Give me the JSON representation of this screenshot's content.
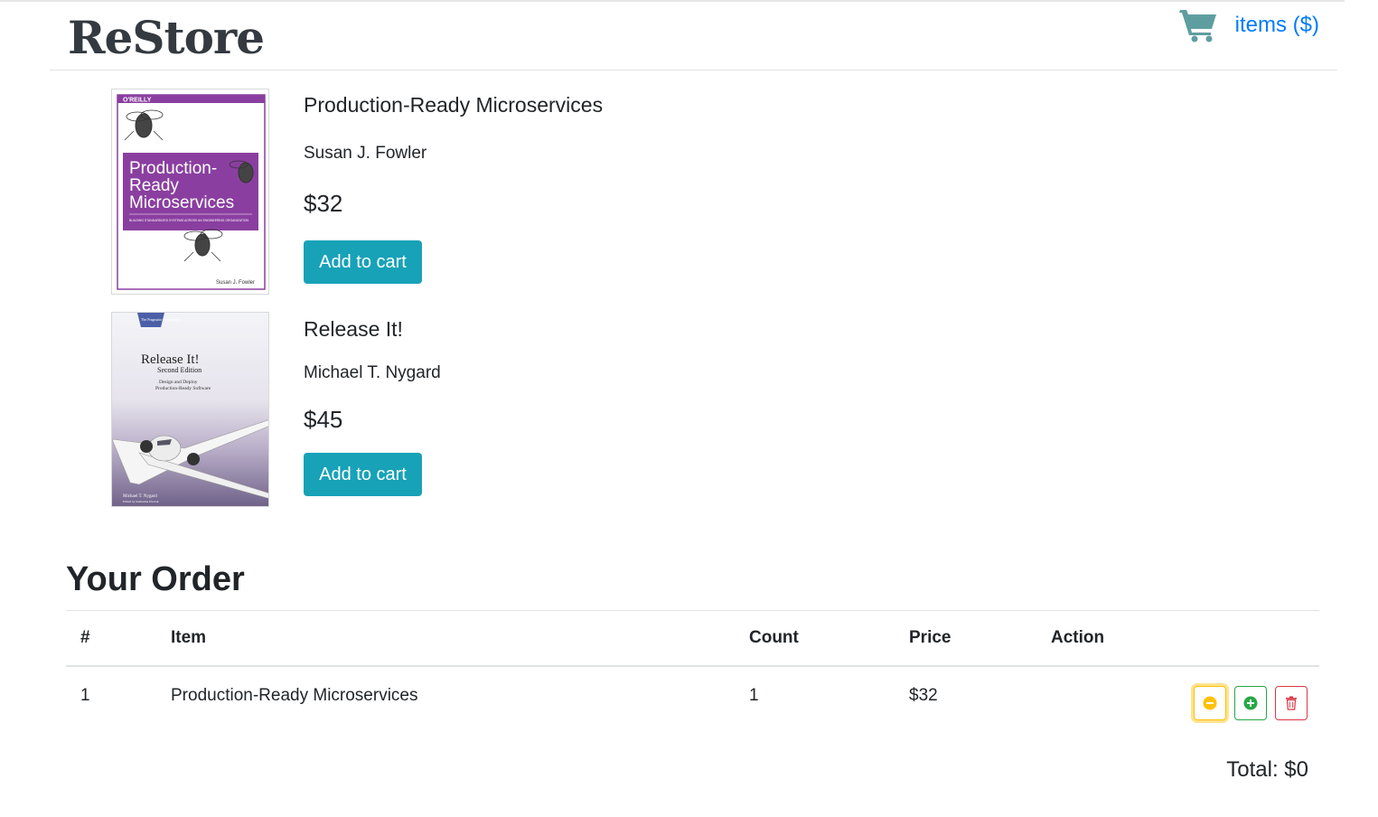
{
  "brand": {
    "name": "ReStore"
  },
  "cart": {
    "label": "items ($)",
    "icon": "shopping-cart-icon",
    "icon_color": "#5f9ea0"
  },
  "products": [
    {
      "title": "Production-Ready Microservices",
      "author": "Susan J. Fowler",
      "price": "$32",
      "button": "Add to cart",
      "cover": {
        "publisher": "O'REILLY",
        "title_lines": [
          "Production-",
          "Ready",
          "Microservices"
        ],
        "subtitle": "BUILDING STANDARDIZED SYSTEMS ACROSS AN ENGINEERING ORGANIZATION",
        "author": "Susan J. Fowler",
        "accent": "#8a3fa0"
      }
    },
    {
      "title": "Release It!",
      "author": "Michael T. Nygard",
      "price": "$45",
      "button": "Add to cart",
      "cover": {
        "publisher": "The Pragmatic Programmers",
        "title": "Release It!",
        "edition": "Second Edition",
        "tagline_1": "Design and Deploy",
        "tagline_2": "Production-Ready Software",
        "author": "Michael T. Nygard",
        "editor": "Edited by Katharine Dvorak",
        "accent": "#4b5fa8"
      }
    }
  ],
  "order": {
    "title": "Your Order",
    "columns": [
      "#",
      "Item",
      "Count",
      "Price",
      "Action"
    ],
    "rows": [
      {
        "num": "1",
        "item": "Production-Ready Microservices",
        "count": "1",
        "price": "$32"
      }
    ],
    "actions": {
      "decrease": "minus-circle-icon",
      "increase": "plus-circle-icon",
      "remove": "trash-icon"
    },
    "total_label": "Total: $0"
  },
  "colors": {
    "primary_button": "#17a2b8",
    "link": "#007bff",
    "warning": "#ffc107",
    "success": "#28a745",
    "danger": "#dc3545"
  }
}
